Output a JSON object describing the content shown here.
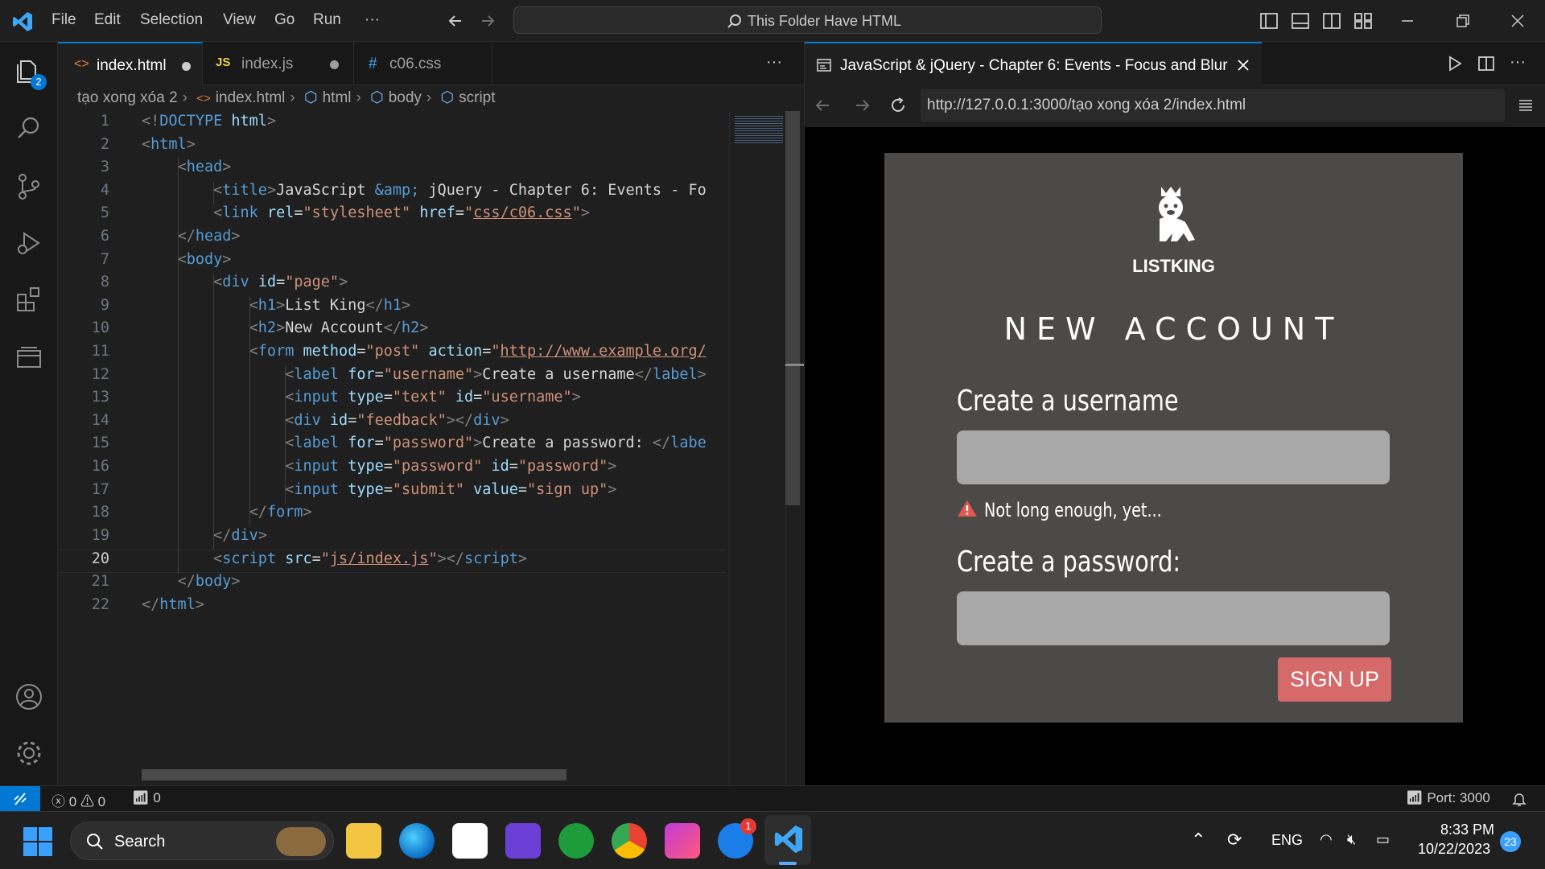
{
  "titlebar": {
    "menu": [
      "File",
      "Edit",
      "Selection",
      "View",
      "Go",
      "Run",
      "···"
    ],
    "search_text": "This Folder Have HTML"
  },
  "activity": {
    "explorer_badge": "2"
  },
  "editor": {
    "tabs": [
      {
        "icon": "<>",
        "label": "index.html",
        "modified": true
      },
      {
        "icon": "JS",
        "label": "index.js",
        "modified": true
      },
      {
        "icon": "#",
        "label": "c06.css",
        "modified": false
      }
    ],
    "more": "···",
    "breadcrumb": [
      "tạo xong xóa 2",
      "index.html",
      "html",
      "body",
      "script"
    ],
    "active_line": 20
  },
  "preview": {
    "tab_title": "JavaScript & jQuery - Chapter 6: Events - Focus and Blur",
    "url": "http://127.0.0.1:3000/tạo xong xóa 2/index.html",
    "logo_text": "LISTKING",
    "heading": "NEW ACCOUNT",
    "username_label": "Create a username",
    "feedback": "Not long enough, yet...",
    "password_label": "Create a password:",
    "submit_label": "SIGN UP"
  },
  "statusbar": {
    "errors": "0",
    "warnings": "0",
    "ports_count": "0",
    "port": "Port: 3000"
  },
  "taskbar": {
    "search_label": "Search",
    "store_badge": "1",
    "language": "ENG",
    "time": "8:33 PM",
    "date": "10/22/2023",
    "notification_count": "23"
  },
  "colors": {
    "accent": "#0078d4",
    "tag": "#569cd6",
    "attr": "#9cdcfe",
    "string": "#ce9178",
    "signup_button": "#d66a6a",
    "page_bg": "#4c4a48"
  }
}
